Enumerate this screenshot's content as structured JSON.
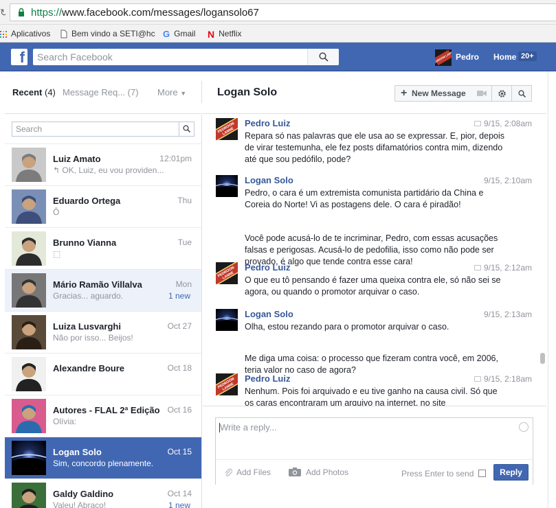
{
  "browser": {
    "url_protocol": "https://",
    "url_rest": "www.facebook.com/messages/logansolo67",
    "bookmarks": [
      {
        "label": "Aplicativos",
        "icon": "apps-grid-icon"
      },
      {
        "label": "Bem vindo a SETI@hc",
        "icon": "page-icon"
      },
      {
        "label": "Gmail",
        "icon": "google-icon"
      },
      {
        "label": "Netflix",
        "icon": "netflix-icon"
      }
    ]
  },
  "fb": {
    "logo": "f",
    "search_placeholder": "Search Facebook",
    "user_name": "Pedro",
    "user_avatar_text": "PEDROOM LANNE",
    "home_label": "Home",
    "home_badge": "20+"
  },
  "left_header": {
    "recent_label": "Recent",
    "recent_count": "(4)",
    "requests_label": "Message Req... (7)",
    "more_label": "More"
  },
  "list_search_placeholder": "Search",
  "conversations": [
    {
      "name": "Luiz Amato",
      "snippet": "OK, Luiz, eu vou providen...",
      "time": "12:01pm",
      "new": "",
      "state": "normal",
      "replied": true
    },
    {
      "name": "Eduardo Ortega",
      "snippet": "Ô",
      "time": "Thu",
      "new": "",
      "state": "normal",
      "replied": false
    },
    {
      "name": "Brunno Vianna",
      "snippet": "⬚",
      "time": "Tue",
      "new": "",
      "state": "normal",
      "replied": false
    },
    {
      "name": "Mário Ramão Villalva",
      "snippet": "Gracias... aguardo.",
      "time": "Mon",
      "new": "1 new",
      "state": "unread",
      "replied": false
    },
    {
      "name": "Luiza Lusvarghi",
      "snippet": "Não por isso... Beijos!",
      "time": "Oct 27",
      "new": "",
      "state": "normal",
      "replied": false
    },
    {
      "name": "Alexandre Boure",
      "snippet": "",
      "time": "Oct 18",
      "new": "",
      "state": "normal",
      "replied": false
    },
    {
      "name": "Autores - FLAL 2ª Edição",
      "snippet": "Olívia:",
      "time": "Oct 16",
      "new": "",
      "state": "normal",
      "replied": false
    },
    {
      "name": "Logan Solo",
      "snippet": "Sim, concordo plenamente.",
      "time": "Oct 15",
      "new": "",
      "state": "active",
      "replied": false
    },
    {
      "name": "Galdy Galdino",
      "snippet": "Valeu! Abraço!",
      "time": "Oct 14",
      "new": "1 new",
      "state": "normal",
      "replied": false
    }
  ],
  "thread": {
    "title": "Logan Solo",
    "new_message_label": "New Message",
    "messages": [
      {
        "sender": "Pedro Luiz",
        "time": "9/15, 2:08am",
        "seen_icon": true,
        "avatar": "pedro",
        "paragraphs": [
          "Repara só nas palavras que ele usa ao se expressar. E, pior, depois de virar testemunha, ele fez posts difamatórios contra mim, dizendo até que sou pedófilo, pode?"
        ]
      },
      {
        "sender": "Logan Solo",
        "time": "9/15, 2:10am",
        "seen_icon": false,
        "avatar": "logan",
        "paragraphs": [
          "Pedro, o cara é um extremista comunista partidário da China e Coreia do Norte! Vi as postagens dele. O cara é piradão!",
          "Você pode acusá-lo de te incriminar, Pedro, com essas acusações falsas e perigosas. Acusá-lo de pedofilia, isso como não pode ser provado, é algo que tende contra esse cara!"
        ]
      },
      {
        "sender": "Pedro Luiz",
        "time": "9/15, 2:12am",
        "seen_icon": true,
        "avatar": "pedro",
        "paragraphs": [
          "O que eu tô pensando é fazer uma queixa contra ele, só não sei se agora, ou quando o promotor arquivar o caso."
        ]
      },
      {
        "sender": "Logan Solo",
        "time": "9/15, 2:13am",
        "seen_icon": false,
        "avatar": "logan",
        "paragraphs": [
          "Olha, estou rezando para o promotor arquivar o caso.",
          "Me diga uma coisa: o processo que fizeram contra você, em 2006, teria valor no caso de agora?"
        ]
      },
      {
        "sender": "Pedro Luiz",
        "time": "9/15, 2:18am",
        "seen_icon": true,
        "avatar": "pedro",
        "paragraphs": [
          "Nenhum. Pois foi arquivado e eu tive ganho na causa civil. Só que os caras encontraram um arquivo na internet, no site"
        ]
      }
    ]
  },
  "composer": {
    "placeholder": "Write a reply...",
    "add_files": "Add Files",
    "add_photos": "Add Photos",
    "press_enter": "Press Enter to send",
    "reply_label": "Reply"
  },
  "colors": {
    "fb_blue": "#4267b2",
    "link_blue": "#365899",
    "unread_bg": "#edf2fa"
  }
}
